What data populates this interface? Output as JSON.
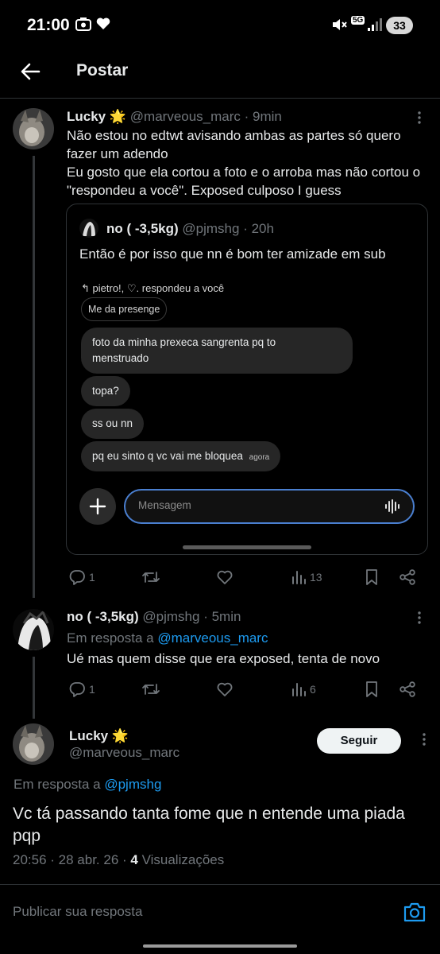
{
  "status_bar": {
    "time": "21:00",
    "battery": "33",
    "network": "5G",
    "icons": [
      "camera-icon",
      "heart-icon",
      "mute-icon",
      "signal-icon"
    ]
  },
  "header": {
    "title": "Postar"
  },
  "post1": {
    "name": "Lucky",
    "emoji": "🌟",
    "handle": "@marveous_marc",
    "time": "· 9min",
    "lines": [
      "Não estou no edtwt avisando ambas as partes só quero",
      "fazer um adendo",
      "Eu gosto que ela cortou a foto e o arroba mas não cortou o",
      "\"respondeu a você\". Exposed culposo I guess"
    ],
    "quote": {
      "name": "no ( -3,5kg)",
      "handle": "@pjmshg",
      "time": "· 20h",
      "text": "Então é por isso que nn é bom ter amizade em sub",
      "screenshot": {
        "reply_header": "pietro!, ♡. respondeu a você",
        "own_message": "Me da presenge",
        "messages": [
          "foto da minha prexeca sangrenta pq to",
          "menstruado",
          "topa?",
          "ss ou nn",
          "pq eu sinto q vc vai me bloquea"
        ],
        "last_time": "agora",
        "input_placeholder": "Mensagem"
      }
    },
    "stats": {
      "replies": "1",
      "views": "13"
    }
  },
  "post2": {
    "name": "no ( -3,5kg)",
    "handle": "@pjmshg",
    "time": "· 5min",
    "reply_prefix": "Em resposta a",
    "reply_to": "@marveous_marc",
    "text": "Ué mas quem disse que era exposed, tenta de novo",
    "stats": {
      "replies": "1",
      "views": "6"
    }
  },
  "main_post": {
    "name": "Lucky",
    "emoji": "🌟",
    "handle": "@marveous_marc",
    "follow_label": "Seguir",
    "reply_prefix": "Em resposta a",
    "reply_to": "@pjmshg",
    "lines": [
      "Vc tá passando tanta fome que n entende uma piada",
      "pqp"
    ],
    "meta_time": "20:56 · 28 abr. 26 ·",
    "views_count": "4",
    "views_label": "Visualizações"
  },
  "reply_bar": {
    "placeholder": "Publicar sua resposta"
  },
  "colors": {
    "accent": "#1d9bf0",
    "muted": "#71767b",
    "text": "#e7e9ea",
    "border": "#2f3336"
  }
}
